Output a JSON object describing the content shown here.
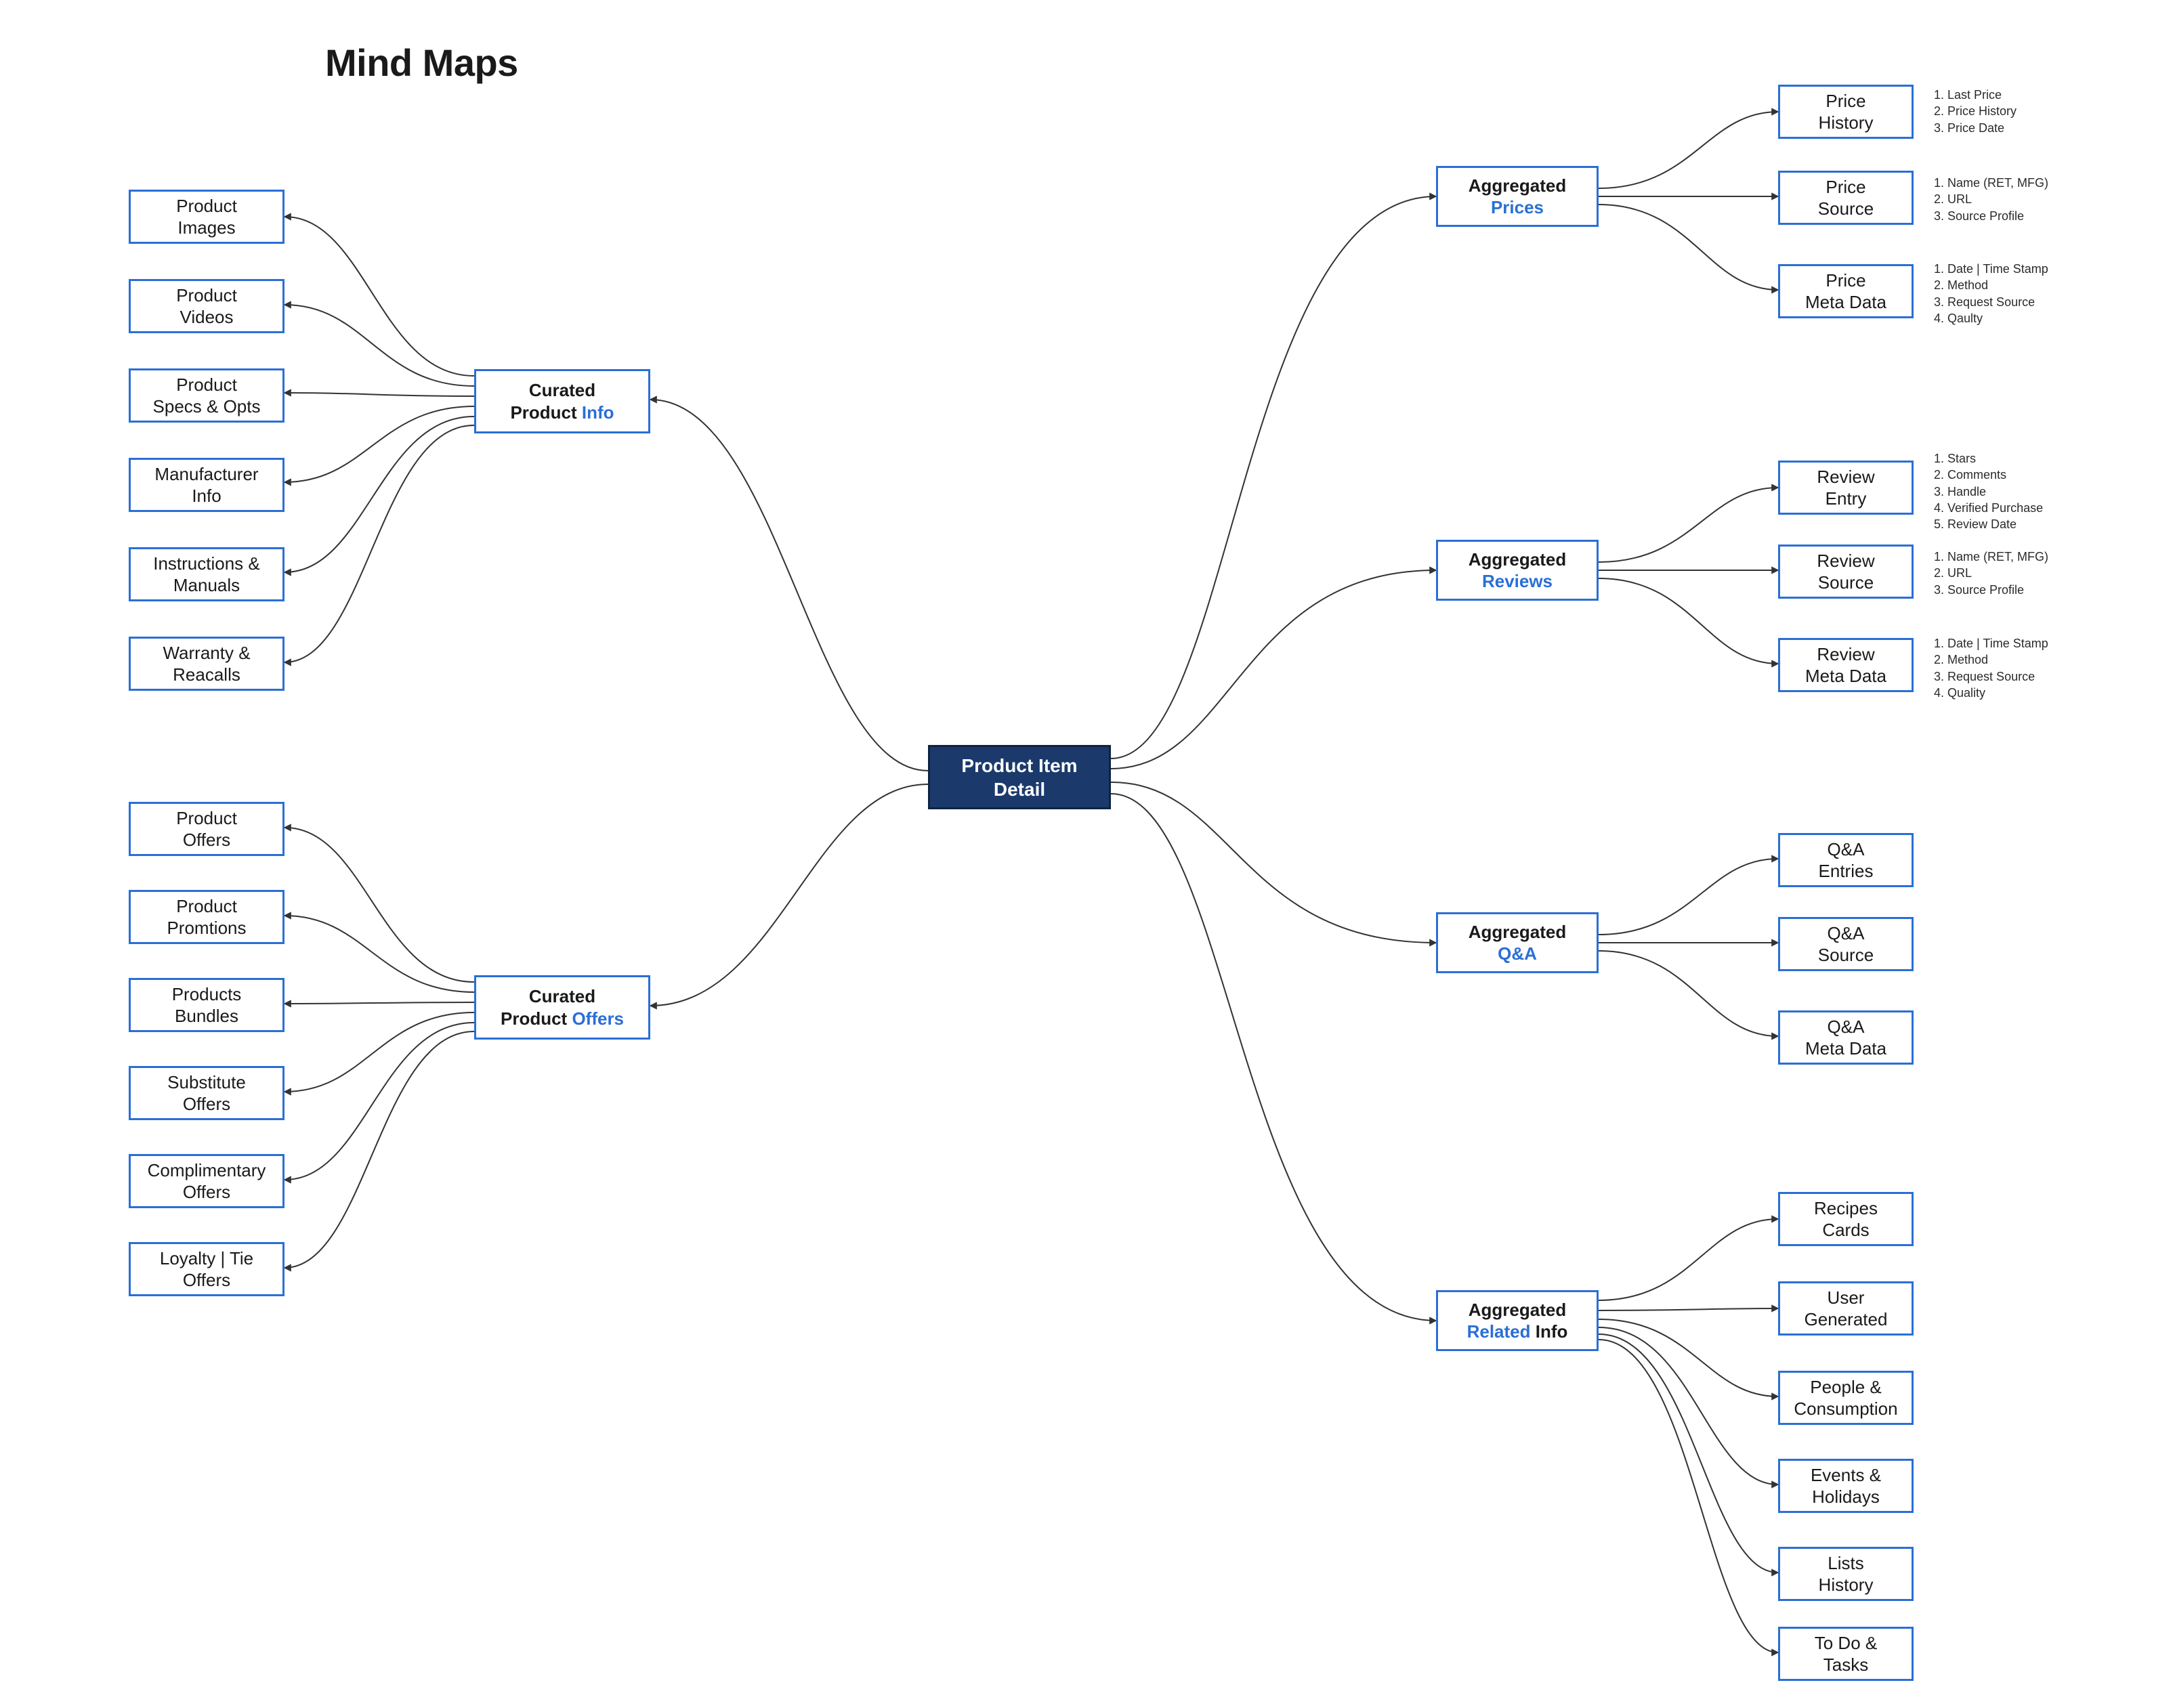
{
  "title": "Mind Maps",
  "root": {
    "line1": "Product Item",
    "line2": "Detail"
  },
  "hubs": {
    "curatedInfo": {
      "line1": "Curated",
      "pre": "Product ",
      "blue": "Info",
      "post": ""
    },
    "curatedOffers": {
      "line1": "Curated",
      "pre": "Product ",
      "blue": "Offers",
      "post": ""
    },
    "aggPrices": {
      "line1": "Aggregated",
      "pre": "",
      "blue": "Prices",
      "post": ""
    },
    "aggReviews": {
      "line1": "Aggregated",
      "pre": "",
      "blue": "Reviews",
      "post": ""
    },
    "aggQA": {
      "line1": "Aggregated",
      "pre": "",
      "blue": "Q&A",
      "post": ""
    },
    "aggRelated": {
      "line1": "Aggregated",
      "pre": "",
      "blue": "Related",
      "post": " Info"
    }
  },
  "leaves": {
    "info0": {
      "l1": "Product",
      "l2": "Images"
    },
    "info1": {
      "l1": "Product",
      "l2": "Videos"
    },
    "info2": {
      "l1": "Product",
      "l2": "Specs & Opts"
    },
    "info3": {
      "l1": "Manufacturer",
      "l2": "Info"
    },
    "info4": {
      "l1": "Instructions &",
      "l2": "Manuals"
    },
    "info5": {
      "l1": "Warranty &",
      "l2": "Reacalls"
    },
    "off0": {
      "l1": "Product",
      "l2": "Offers"
    },
    "off1": {
      "l1": "Product",
      "l2": "Promtions"
    },
    "off2": {
      "l1": "Products",
      "l2": "Bundles"
    },
    "off3": {
      "l1": "Substitute",
      "l2": "Offers"
    },
    "off4": {
      "l1": "Complimentary",
      "l2": "Offers"
    },
    "off5": {
      "l1": "Loyalty | Tie",
      "l2": "Offers"
    },
    "pr0": {
      "l1": "Price",
      "l2": "History"
    },
    "pr1": {
      "l1": "Price",
      "l2": "Source"
    },
    "pr2": {
      "l1": "Price",
      "l2": "Meta Data"
    },
    "rv0": {
      "l1": "Review",
      "l2": "Entry"
    },
    "rv1": {
      "l1": "Review",
      "l2": "Source"
    },
    "rv2": {
      "l1": "Review",
      "l2": "Meta Data"
    },
    "qa0": {
      "l1": "Q&A",
      "l2": "Entries"
    },
    "qa1": {
      "l1": "Q&A",
      "l2": "Source"
    },
    "qa2": {
      "l1": "Q&A",
      "l2": "Meta Data"
    },
    "rl0": {
      "l1": "Recipes",
      "l2": "Cards"
    },
    "rl1": {
      "l1": "User",
      "l2": "Generated"
    },
    "rl2": {
      "l1": "People &",
      "l2": "Consumption"
    },
    "rl3": {
      "l1": "Events &",
      "l2": "Holidays"
    },
    "rl4": {
      "l1": "Lists",
      "l2": "History"
    },
    "rl5": {
      "l1": "To Do &",
      "l2": "Tasks"
    }
  },
  "annotations": {
    "prHistory": "1. Last Price\n2. Price History\n3. Price Date",
    "prSource": "1. Name (RET, MFG)\n2. URL\n3. Source Profile",
    "prMeta": "1. Date | Time Stamp\n2. Method\n3. Request Source\n4. Qaulty",
    "rvEntry": "1. Stars\n2. Comments\n3. Handle\n4. Verified Purchase\n5. Review Date",
    "rvSource": "1. Name (RET, MFG)\n2. URL\n3. Source Profile",
    "rvMeta": "1. Date | Time Stamp\n2. Method\n3. Request Source\n4. Quality"
  }
}
